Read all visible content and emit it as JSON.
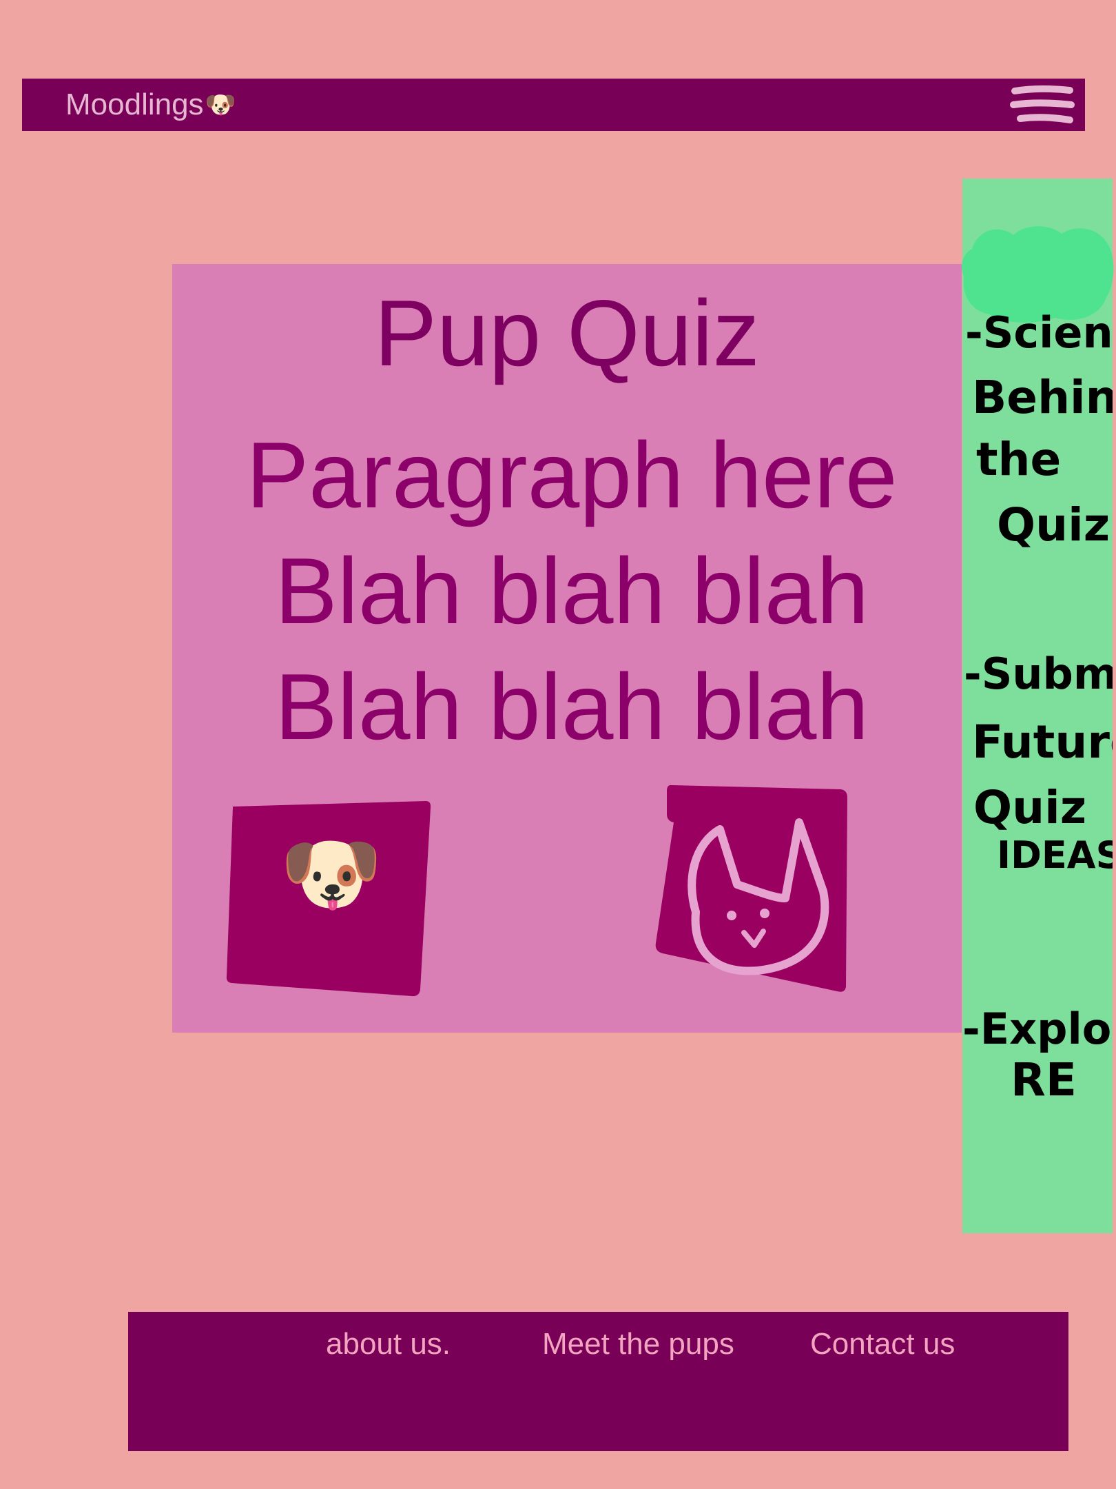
{
  "header": {
    "brand": "Moodlings",
    "brand_emoji": "🐶"
  },
  "main": {
    "title": "Pup Quiz",
    "paragraph_lines": [
      "Paragraph here",
      "Blah blah blah",
      "Blah blah blah"
    ],
    "tiles": [
      {
        "name": "dog",
        "emoji": "🐶"
      },
      {
        "name": "cat",
        "icon": "cat-face-icon"
      }
    ]
  },
  "sidebar": {
    "items": [
      {
        "lines": [
          "-Science",
          "Behind",
          "the",
          "Quiz"
        ]
      },
      {
        "lines": [
          "-Submit",
          "Future",
          "Quiz",
          "IDEAS"
        ]
      },
      {
        "lines": [
          "-Explo",
          "RE"
        ]
      }
    ]
  },
  "footer": {
    "links": [
      "about us.",
      "Meet the pups",
      "Contact us"
    ]
  },
  "colors": {
    "page_bg": "#efa5a1",
    "bar": "#780056",
    "card": "#d97fb6",
    "card_text": "#8c006a",
    "tile": "#9a0060",
    "sidebar": "#7ddf9b",
    "sidebar_blob": "#4fe38f",
    "footer_text": "#f2a4c1"
  }
}
